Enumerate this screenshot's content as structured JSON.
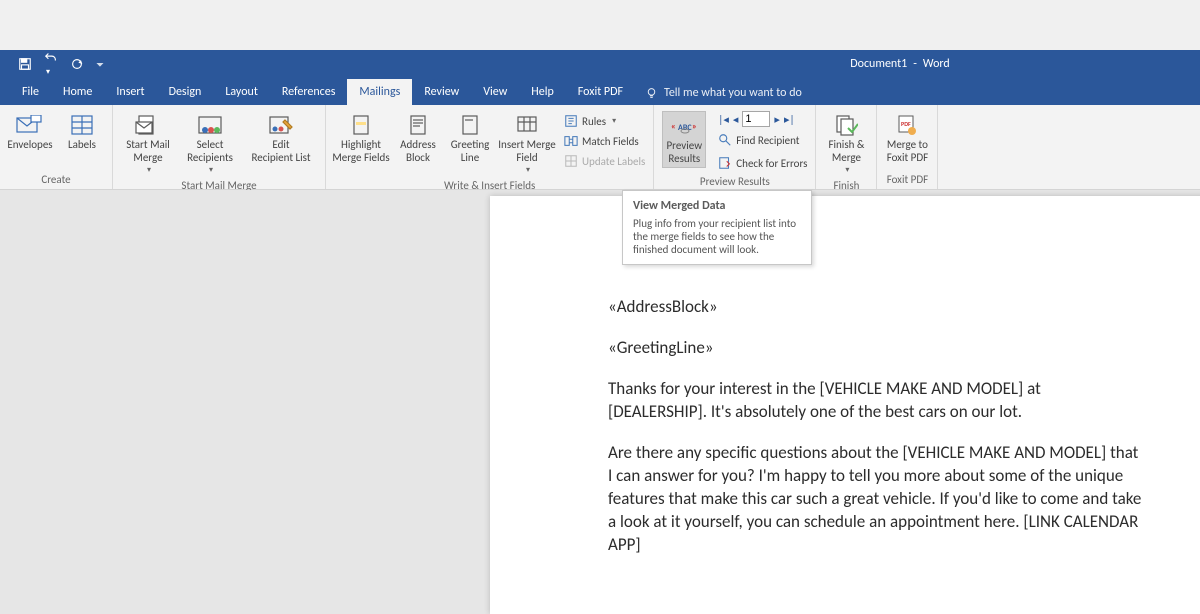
{
  "title": {
    "doc": "Document1",
    "sep": "-",
    "app": "Word"
  },
  "tabs": {
    "file": "File",
    "home": "Home",
    "insert": "Insert",
    "design": "Design",
    "layout": "Layout",
    "references": "References",
    "mailings": "Mailings",
    "review": "Review",
    "view": "View",
    "help": "Help",
    "foxit": "Foxit PDF",
    "tellme": "Tell me what you want to do"
  },
  "ribbon": {
    "create": {
      "label": "Create",
      "envelopes": "Envelopes",
      "labels": "Labels"
    },
    "startmerge": {
      "label": "Start Mail Merge",
      "start": "Start Mail\nMerge",
      "select": "Select\nRecipients",
      "edit": "Edit\nRecipient List"
    },
    "writeinsert": {
      "label": "Write & Insert Fields",
      "highlight": "Highlight\nMerge Fields",
      "address": "Address\nBlock",
      "greeting": "Greeting\nLine",
      "insertfield": "Insert Merge\nField",
      "rules": "Rules",
      "match": "Match Fields",
      "update": "Update Labels"
    },
    "preview": {
      "label": "Preview Results",
      "preview": "Preview\nResults",
      "record": "1",
      "find": "Find Recipient",
      "check": "Check for Errors"
    },
    "finish": {
      "label": "Finish",
      "finish": "Finish &\nMerge"
    },
    "foxit": {
      "label": "Foxit PDF",
      "merge": "Merge to\nFoxit PDF"
    }
  },
  "tooltip": {
    "title": "View Merged Data",
    "body": "Plug info from your recipient list into the merge fields to see how the finished document will look."
  },
  "document": {
    "address": "«AddressBlock»",
    "greeting": "«GreetingLine»",
    "p1": "Thanks for your interest in the [VEHICLE MAKE AND MODEL] at [DEALERSHIP]. It's absolutely one of the best cars on our lot.",
    "p2": "Are there any specific questions about the [VEHICLE MAKE AND MODEL] that I can answer for you? I'm happy to tell you more about some of the unique features that make this car such a great vehicle. If you'd like to come and take a look at it yourself, you can schedule an appointment here. [LINK CALENDAR APP]"
  }
}
